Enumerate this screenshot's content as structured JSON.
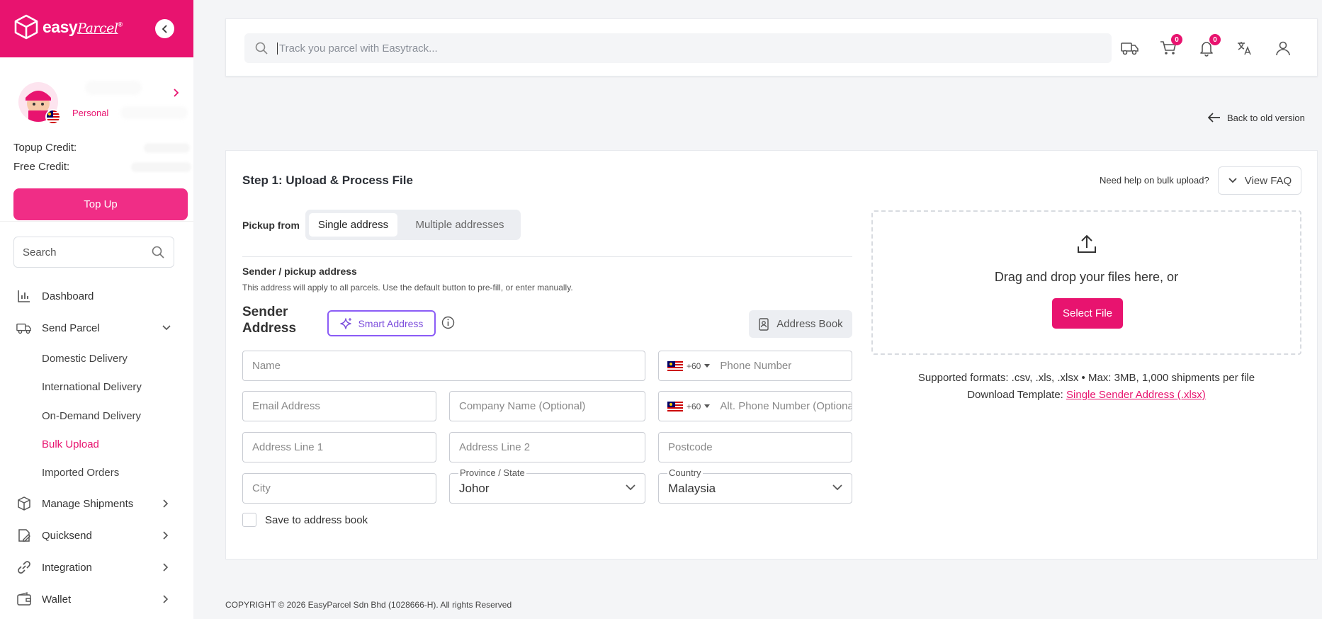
{
  "brand": {
    "name_bold": "easy",
    "name_script": "Parcel",
    "trademark": "®"
  },
  "profile": {
    "account_type": "Personal"
  },
  "credits": {
    "topup_label": "Topup Credit:",
    "free_label": "Free Credit:"
  },
  "topup_button": "Top Up",
  "sidebar_search": {
    "placeholder": "Search"
  },
  "nav": {
    "dashboard": "Dashboard",
    "send_parcel": "Send Parcel",
    "sub": {
      "domestic": "Domestic Delivery",
      "international": "International Delivery",
      "on_demand": "On-Demand Delivery",
      "bulk": "Bulk Upload",
      "imported": "Imported Orders"
    },
    "manage": "Manage Shipments",
    "quicksend": "Quicksend",
    "integration": "Integration",
    "wallet": "Wallet"
  },
  "topbar": {
    "search_placeholder": "Track you parcel with Easytrack...",
    "cart_count": "0",
    "notif_count": "0"
  },
  "back_link": "Back to old version",
  "card": {
    "step_title": "Step 1: Upload & Process File",
    "help_text": "Need help on bulk upload?",
    "faq_button": "View FAQ",
    "pickup_label": "Pickup from",
    "pickup_options": [
      "Single address",
      "Multiple addresses"
    ],
    "section_title": "Sender / pickup address",
    "section_desc": "This address will apply to all parcels. Use the default button to pre-fill, or enter manually.",
    "sender_title": "Sender Address",
    "smart_address": "Smart Address",
    "address_book": "Address Book",
    "fields": {
      "name": "Name",
      "phone_code": "+60",
      "phone": "Phone Number",
      "email": "Email Address",
      "company": "Company Name (Optional)",
      "alt_phone": "Alt. Phone Number (Optional)",
      "address1": "Address Line 1",
      "address2": "Address Line 2",
      "postcode": "Postcode",
      "city": "City",
      "state_label": "Province / State",
      "state_value": "Johor",
      "country_label": "Country",
      "country_value": "Malaysia"
    },
    "save_label": "Save to address book",
    "dropzone_text": "Drag and drop your files here, or",
    "select_file": "Select File",
    "formats": "Supported formats: .csv, .xls, .xlsx • Max: 3MB, 1,000 shipments per file",
    "template_label": "Download Template:",
    "template_link": "Single Sender Address (.xlsx)"
  },
  "footer": "COPYRIGHT © 2026 EasyParcel Sdn Bhd (1028666-H). All rights Reserved",
  "colors": {
    "brand": "#e8136f",
    "accent_purple": "#8b5cf6"
  }
}
